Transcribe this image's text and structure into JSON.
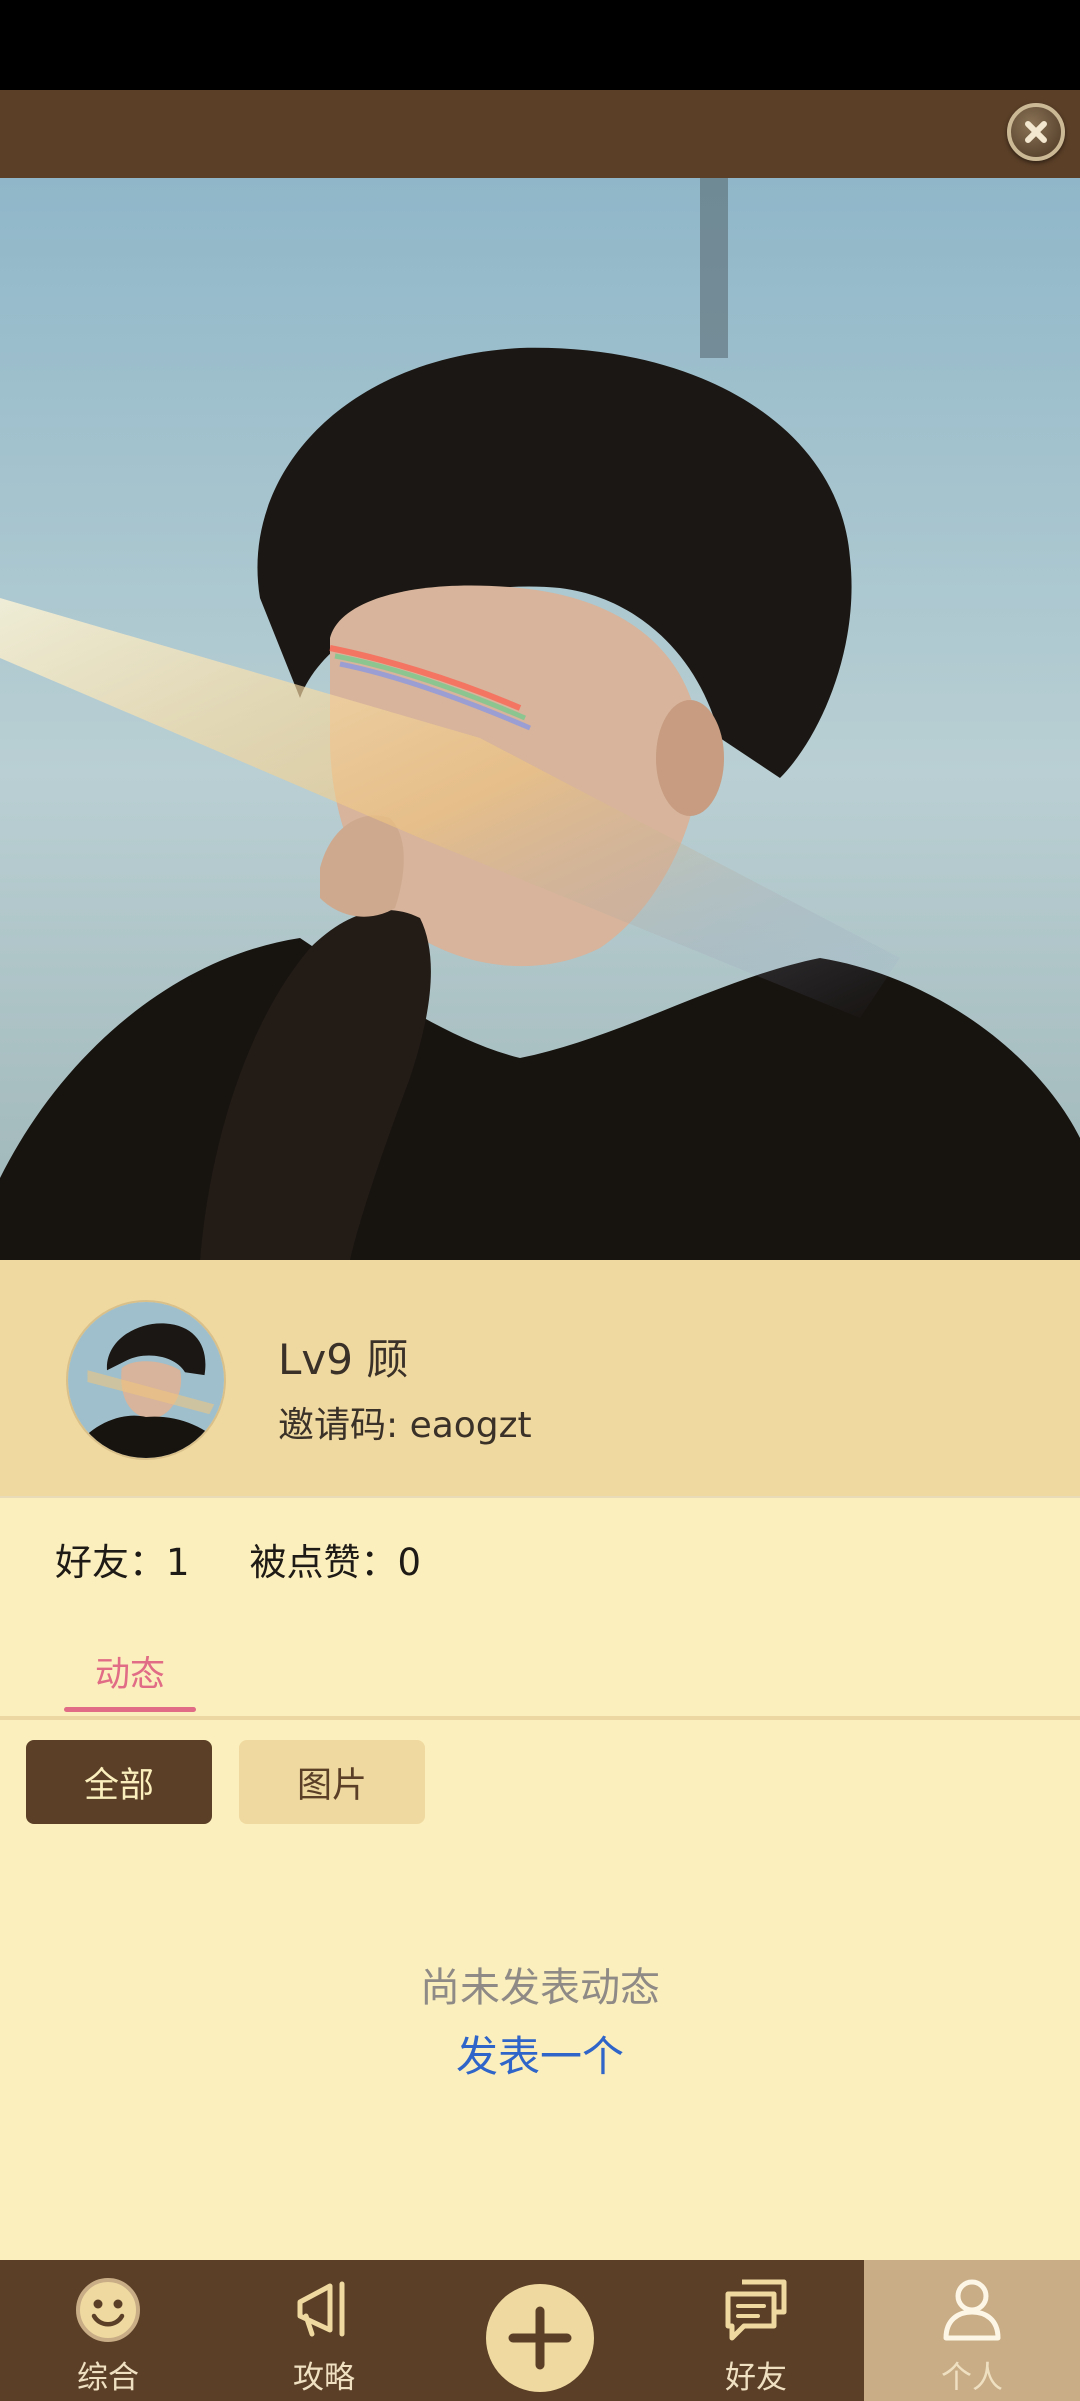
{
  "profile": {
    "level_name": "Lv9 顾",
    "invite_label": "邀请码: eaogzt"
  },
  "stats": {
    "friends": "好友：1",
    "likes": "被点赞：0"
  },
  "tabs": [
    {
      "label": "动态",
      "active": true
    }
  ],
  "filters": {
    "all": "全部",
    "images": "图片",
    "selected": "全部"
  },
  "empty_state": {
    "message": "尚未发表动态",
    "action": "发表一个"
  },
  "bottom_nav": [
    {
      "label": "综合",
      "icon": "smiley-icon"
    },
    {
      "label": "攻略",
      "icon": "megaphone-icon"
    },
    {
      "label": "",
      "icon": "plus-icon"
    },
    {
      "label": "好友",
      "icon": "chat-icon"
    },
    {
      "label": "个人",
      "icon": "person-icon",
      "active": true
    }
  ],
  "colors": {
    "brown": "#5b3f27",
    "tan": "#f0d9a0",
    "cream": "#fbf0bd",
    "accent_pink": "#e06c86",
    "link_blue": "#2f64c8"
  }
}
